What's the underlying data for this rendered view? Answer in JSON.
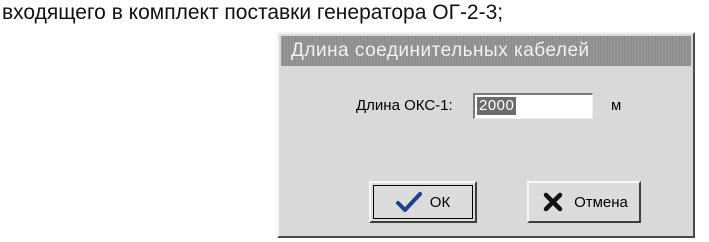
{
  "document": {
    "text_line": "входящего в комплект поставки генератора ОГ-2-3;"
  },
  "dialog": {
    "title": "Длина соединительных кабелей",
    "field_label": "Длина ОКС-1:",
    "field_value": "2000",
    "unit": "м",
    "ok_label": "ОК",
    "cancel_label": "Отмена"
  },
  "icons": {
    "ok": "checkmark-icon",
    "cancel": "x-icon"
  },
  "colors": {
    "dialog_bg": "#d9d9d9",
    "titlebar": "#8f8f8f",
    "selection": "#6c6c6c"
  }
}
